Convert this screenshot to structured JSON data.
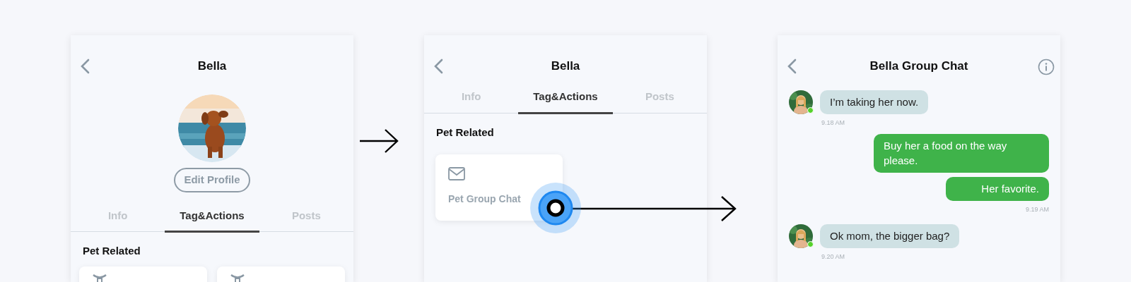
{
  "screens": [
    {
      "kind": "profile",
      "title": "Bella",
      "button": "Edit Profile",
      "tabs": [
        {
          "label": "Info",
          "selected": false
        },
        {
          "label": "Tag&Actions",
          "selected": true
        },
        {
          "label": "Posts",
          "selected": false
        }
      ],
      "section": "Pet Related",
      "cards": [
        {
          "kind": "collar"
        },
        {
          "kind": "collar"
        }
      ]
    },
    {
      "kind": "tags",
      "title": "Bella",
      "tabs": [
        {
          "label": "Info",
          "selected": false
        },
        {
          "label": "Tag&Actions",
          "selected": true
        },
        {
          "label": "Posts",
          "selected": false
        }
      ],
      "section": "Pet Related",
      "cards": [
        {
          "kind": "mail",
          "label": "Pet Group Chat",
          "tapped": true
        }
      ]
    },
    {
      "kind": "chat",
      "title": "Bella Group Chat",
      "messages": [
        {
          "sent": false,
          "online": true,
          "text": "I’m taking her now.",
          "time": "9.18 AM"
        },
        {
          "sent": true,
          "text": "Buy her a food on the way please."
        },
        {
          "sent": true,
          "text": "Her favorite.",
          "time": "9.19 AM"
        },
        {
          "sent": false,
          "online": true,
          "text": "Ok mom, the bigger bag?",
          "time": "9.20 AM"
        }
      ]
    }
  ]
}
